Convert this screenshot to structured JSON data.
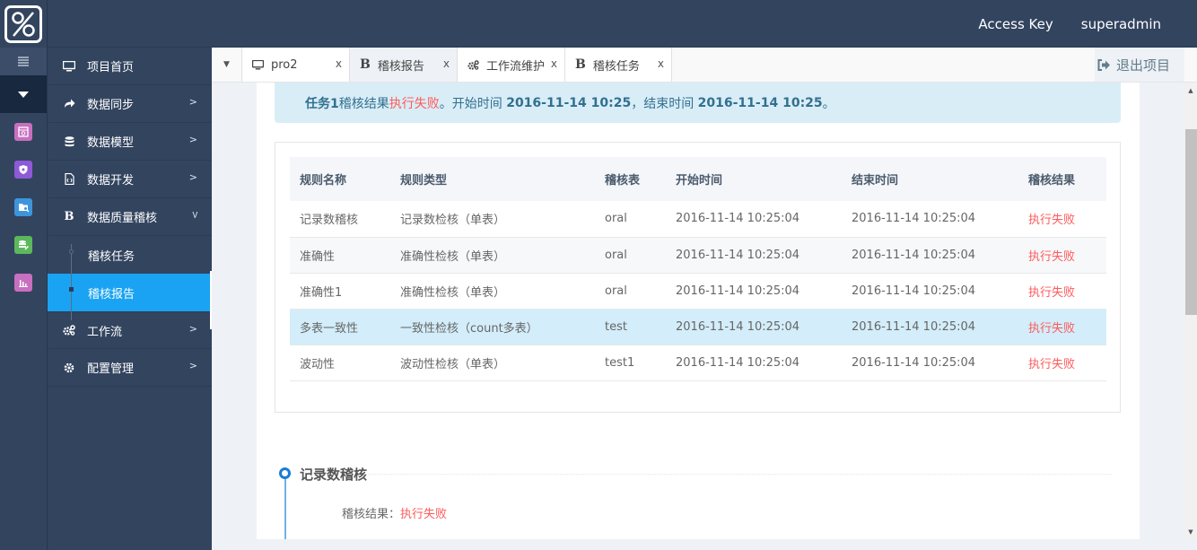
{
  "header": {
    "logo_icon": "percent-logo-icon",
    "access_key_label": "Access Key",
    "username": "superadmin"
  },
  "rail": {
    "items": [
      {
        "icon": "calendar-icon",
        "color": "#c86fc0"
      },
      {
        "icon": "shield-icon",
        "color": "#8e5ad8"
      },
      {
        "icon": "folder-search-icon",
        "color": "#3d95dc"
      },
      {
        "icon": "database-edit-icon",
        "color": "#5cb85c"
      },
      {
        "icon": "bar-chart-icon",
        "color": "#c86fc0"
      }
    ]
  },
  "sidebar": {
    "items": [
      {
        "label": "项目首页",
        "icon": "monitor-icon"
      },
      {
        "label": "数据同步",
        "icon": "share-icon"
      },
      {
        "label": "数据模型",
        "icon": "database-icon"
      },
      {
        "label": "数据开发",
        "icon": "file-code-icon"
      },
      {
        "label": "数据质量稽核",
        "icon": "bold-b-icon"
      },
      {
        "label": "工作流",
        "icon": "cogs-icon"
      },
      {
        "label": "配置管理",
        "icon": "gear-icon"
      }
    ],
    "sub_items": [
      {
        "label": "稽核任务"
      },
      {
        "label": "稽核报告",
        "active": true
      }
    ]
  },
  "tabs": [
    {
      "label": "pro2",
      "icon": "monitor-icon",
      "close": "x"
    },
    {
      "label": "稽核报告",
      "icon": "bold-b-icon",
      "close": "x",
      "active": true
    },
    {
      "label": "工作流维护",
      "icon": "cogs-icon",
      "close": "x"
    },
    {
      "label": "稽核任务",
      "icon": "bold-b-icon",
      "close": "x"
    }
  ],
  "exit_button": {
    "label": "退出项目",
    "icon": "sign-out-icon"
  },
  "alert": {
    "task": "任务1",
    "result_label": "稽核结果",
    "result": "执行失败",
    "start_label": "。开始时间 ",
    "start_time": "2016-11-14 10:25",
    "end_label": "，结束时间 ",
    "end_time": "2016-11-14 10:25",
    "end_punct": "。"
  },
  "table": {
    "columns": [
      "规则名称",
      "规则类型",
      "稽核表",
      "开始时间",
      "结束时间",
      "稽核结果"
    ],
    "rows": [
      [
        "记录数稽核",
        "记录数检核（单表）",
        "oral",
        "2016-11-14 10:25:04",
        "2016-11-14 10:25:04",
        "执行失败"
      ],
      [
        "准确性",
        "准确性检核（单表）",
        "oral",
        "2016-11-14 10:25:04",
        "2016-11-14 10:25:04",
        "执行失败"
      ],
      [
        "准确性1",
        "准确性检核（单表）",
        "oral",
        "2016-11-14 10:25:04",
        "2016-11-14 10:25:04",
        "执行失败"
      ],
      [
        "多表一致性",
        "一致性检核（count多表）",
        "test",
        "2016-11-14 10:25:04",
        "2016-11-14 10:25:04",
        "执行失败"
      ],
      [
        "波动性",
        "波动性检核（单表）",
        "test1",
        "2016-11-14 10:25:04",
        "2016-11-14 10:25:04",
        "执行失败"
      ]
    ],
    "highlighted_row": 3
  },
  "timeline": {
    "title": "记录数稽核",
    "result_label": "稽核结果：",
    "result": "执行失败"
  },
  "colors": {
    "header_bg": "#33445f",
    "active_nav": "#1aa3f2",
    "fail": "#ff5a5a",
    "alert_bg": "#d9edf7",
    "alert_text": "#31708f"
  }
}
